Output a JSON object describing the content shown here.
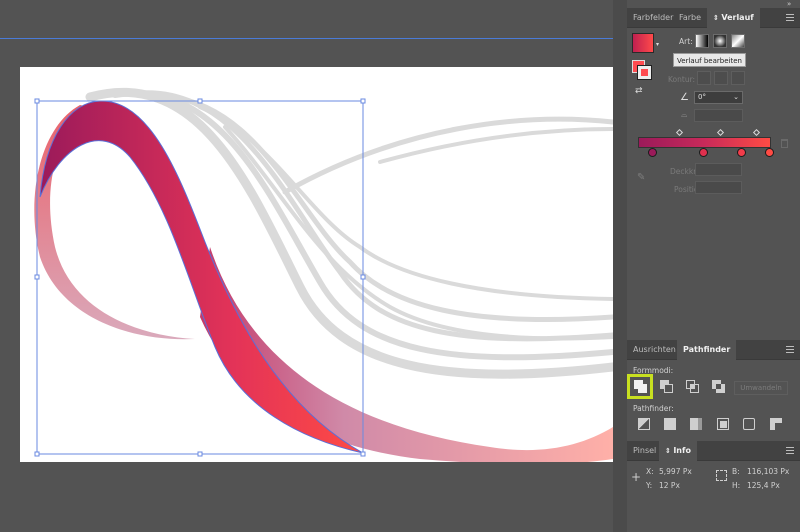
{
  "panel_gradient": {
    "tabs": [
      "Farbfelder",
      "Farbe",
      "Verlauf"
    ],
    "active_tab": "Verlauf",
    "type_label": "Art:",
    "tooltip": "Verlauf bearbeiten",
    "stroke_label": "Kontur:",
    "angle_value": "0°",
    "opacity_label": "Deckkraft:",
    "position_label": "Position:",
    "colors": {
      "start": "#9b1a5a",
      "mid": "#c82a5a",
      "end": "#ff4b44"
    }
  },
  "panel_pathfinder": {
    "tabs": [
      "Ausrichten",
      "Pathfinder"
    ],
    "active_tab": "Pathfinder",
    "shape_modes_label": "Formmodi:",
    "expand_button": "Umwandeln",
    "pathfinders_label": "Pathfinder:"
  },
  "panel_info": {
    "tabs": [
      "Pinsel",
      "Info"
    ],
    "active_tab": "Info",
    "x_label": "X:",
    "x_value": "5,997 Px",
    "y_label": "Y:",
    "y_value": "12 Px",
    "w_label": "B:",
    "w_value": "116,103 Px",
    "h_label": "H:",
    "h_value": "125,4 Px"
  }
}
